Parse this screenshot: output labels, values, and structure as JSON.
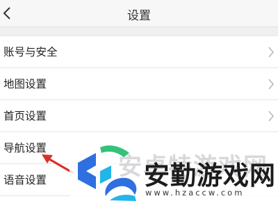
{
  "header": {
    "title": "设置",
    "back_icon": "chevron-left-icon"
  },
  "settings": {
    "items": [
      {
        "label": "账号与安全",
        "icon": "chevron-right-icon"
      },
      {
        "label": "地图设置",
        "icon": "chevron-right-icon"
      },
      {
        "label": "首页设置",
        "icon": "chevron-right-icon"
      },
      {
        "label": "导航设置"
      },
      {
        "label": "语音设置"
      }
    ]
  },
  "annotation": {
    "arrow_color": "#d9302c",
    "target": "导航设置"
  },
  "watermark": {
    "name": "安勤游戏网",
    "url": "www.hzaccw.com",
    "ghost_text": "安卓特游戏网",
    "colors": {
      "blue": "#2f6fe0",
      "cyan": "#23b5e8",
      "green": "#34c27a"
    }
  },
  "colors": {
    "titlebar_bg": "#f7f7f7",
    "divider": "#e4e4e4",
    "text": "#222222",
    "chevron": "#b8b8b8"
  }
}
